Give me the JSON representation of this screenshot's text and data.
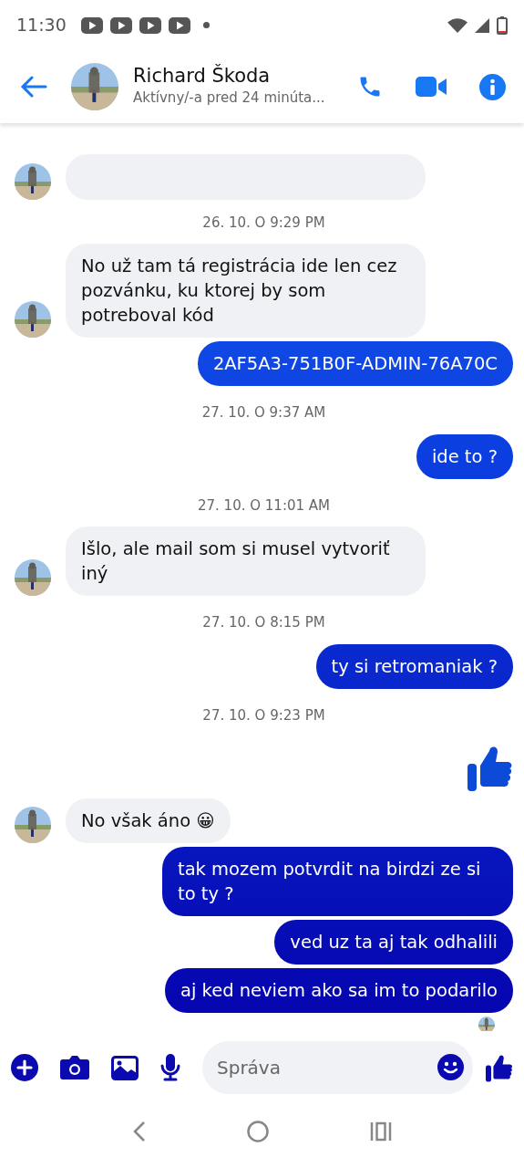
{
  "status_bar": {
    "time": "11:30",
    "notifications": [
      {
        "kind": "video"
      },
      {
        "kind": "video"
      },
      {
        "kind": "video"
      },
      {
        "kind": "video"
      }
    ]
  },
  "header": {
    "name": "Richard Škoda",
    "status": "Aktívny/-a pred 24 minúta..."
  },
  "messages": [
    {
      "kind": "partial"
    },
    {
      "kind": "timestamp",
      "text": "26. 10. O 9:29 PM"
    },
    {
      "kind": "received",
      "text": "No už tam tá registrácia ide len cez pozvánku, ku ktorej by som potreboval kód"
    },
    {
      "kind": "sent",
      "text": "2AF5A3-751B0F-ADMIN-76A70C"
    },
    {
      "kind": "timestamp",
      "text": "27. 10. O 9:37 AM"
    },
    {
      "kind": "sent",
      "text": "ide to ?"
    },
    {
      "kind": "timestamp",
      "text": "27. 10. O 11:01 AM"
    },
    {
      "kind": "received",
      "text": "Išlo, ale mail som si musel vytvoriť iný"
    },
    {
      "kind": "timestamp",
      "text": "27. 10. O 8:15 PM"
    },
    {
      "kind": "sent",
      "text": "ty si retromaniak ?"
    },
    {
      "kind": "timestamp",
      "text": "27. 10. O 9:23 PM"
    },
    {
      "kind": "like"
    },
    {
      "kind": "received",
      "text": "No však áno 😀"
    },
    {
      "kind": "sent",
      "text": "tak mozem potvrdit na birdzi ze si to ty ?"
    },
    {
      "kind": "sent",
      "text": "ved uz ta aj tak odhalili"
    },
    {
      "kind": "sent",
      "text": "aj ked neviem ako sa im to podarilo"
    }
  ],
  "composer": {
    "placeholder": "Správa"
  }
}
